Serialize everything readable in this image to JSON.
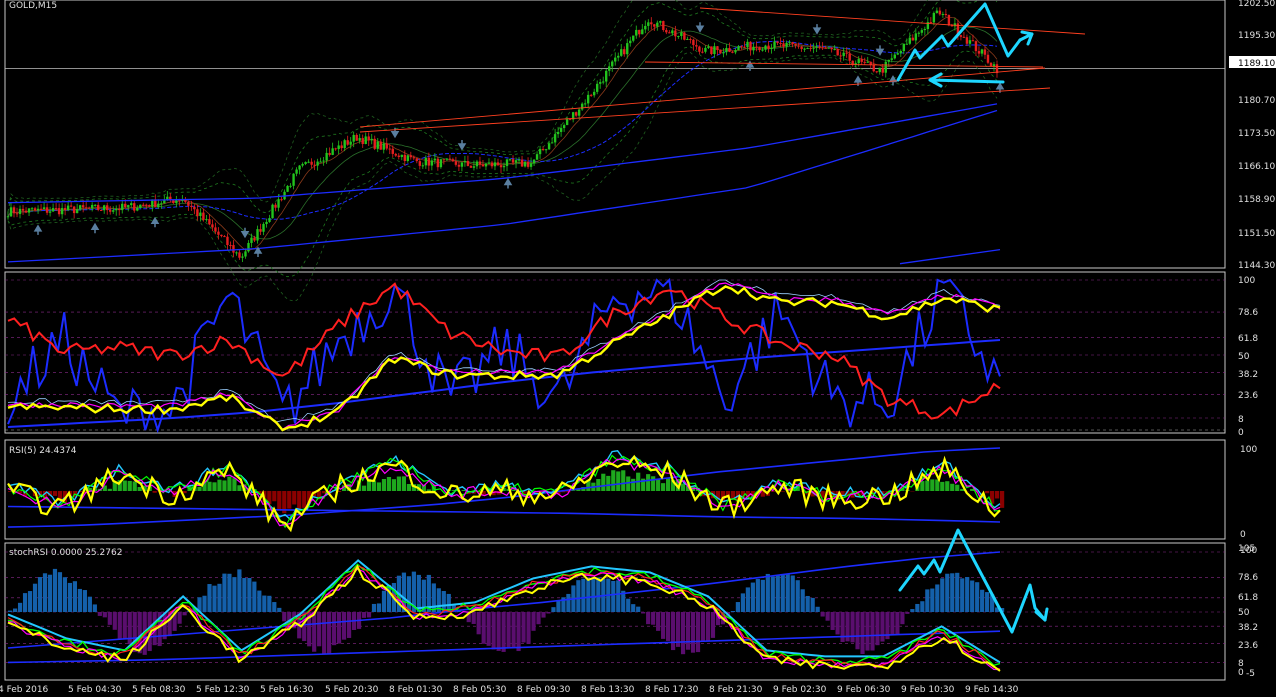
{
  "colors": {
    "background": "#000000",
    "frame": "#c8c8c8",
    "grid": "#3a3a3a",
    "bull_candle": "#22c41d",
    "bear_candle": "#e51f1f",
    "fractal_arrow": "#5a7fa0",
    "trendline": "#ff4020",
    "channel": "#1c2cff",
    "annotation": "#1ed6ff",
    "band_dashed": "#1f7a1f",
    "price_line": "#c0c0c0",
    "yellow": "#ffff00",
    "red": "#ff2020",
    "blue": "#1c2cff",
    "cyan": "#23c7ff",
    "magenta": "#ff00ff",
    "green": "#00ff00",
    "hist_green": "#1ea81e",
    "hist_red": "#8b0000",
    "hist_blue": "#1460aa",
    "hist_purple": "#5a0e6e",
    "level_dash": "#8a2a8a"
  },
  "chart_data": [
    {
      "panel": "main",
      "type": "candlestick",
      "title": "GOLD,M15",
      "current_price_label": "1189.10",
      "y_tick_labels": [
        "1202.50",
        "1195.30",
        "1189.10",
        "1180.70",
        "1173.50",
        "1166.10",
        "1158.90",
        "1151.50",
        "1144.30"
      ],
      "ylim": [
        1144.3,
        1204.0
      ],
      "approx_close_path": [
        [
          "5 Feb 2016",
          1156.5
        ],
        [
          "5 Feb 04:30",
          1156.9
        ],
        [
          "5 Feb 08:30",
          1157.3
        ],
        [
          "5 Feb 12:30",
          1159.5
        ],
        [
          "5 Feb 16:30",
          1146.0
        ],
        [
          "5 Feb 20:30",
          1166.0
        ],
        [
          "5 Feb 22:30",
          1173.5
        ],
        [
          "8 Feb 01:30",
          1168.0
        ],
        [
          "8 Feb 05:30",
          1167.0
        ],
        [
          "8 Feb 09:30",
          1167.5
        ],
        [
          "8 Feb 13:30",
          1183.0
        ],
        [
          "8 Feb 17:30",
          1200.5
        ],
        [
          "8 Feb 21:30",
          1193.0
        ],
        [
          "9 Feb 02:30",
          1194.5
        ],
        [
          "9 Feb 06:30",
          1193.5
        ],
        [
          "9 Feb 10:30",
          1188.5
        ],
        [
          "9 Feb 14:30",
          1202.0
        ],
        [
          "9 Feb 15:30",
          1189.1
        ]
      ]
    },
    {
      "panel": "indicator-1",
      "type": "line",
      "y_tick_labels": [
        "100",
        "78.6",
        "61.8",
        "50",
        "38.2",
        "23.6",
        "8",
        "0"
      ],
      "ylim": [
        0,
        100
      ],
      "series": [
        {
          "color": "yellow",
          "values": [
            15,
            15,
            14,
            14,
            22,
            0,
            12,
            48,
            37,
            36,
            37,
            58,
            77,
            97,
            85,
            85,
            75,
            88,
            80
          ]
        },
        {
          "color": "red",
          "values": [
            74,
            52,
            55,
            50,
            60,
            35,
            70,
            96,
            65,
            52,
            48,
            78,
            95,
            75,
            58,
            50,
            20,
            10,
            30
          ]
        },
        {
          "color": "blue",
          "values": [
            20,
            60,
            10,
            15,
            90,
            10,
            60,
            95,
            20,
            55,
            20,
            90,
            95,
            20,
            80,
            20,
            20,
            95,
            30
          ]
        }
      ]
    },
    {
      "panel": "indicator-2",
      "type": "line",
      "label": "RSI(5) 24.4374",
      "y_tick_labels": [
        "100",
        "0"
      ],
      "ylim": [
        0,
        100
      ],
      "series": [
        {
          "name": "RSI(5)",
          "color": "yellow",
          "values": [
            50,
            30,
            70,
            45,
            75,
            10,
            55,
            80,
            45,
            50,
            45,
            85,
            70,
            30,
            55,
            40,
            45,
            75,
            24
          ]
        }
      ]
    },
    {
      "panel": "indicator-3",
      "type": "line",
      "label": "stochRSI 0.0000 25.2762",
      "y_tick_labels": [
        "105",
        "100",
        "78.6",
        "61.8",
        "50",
        "38.2",
        "23.6",
        "8",
        "0",
        "-5"
      ],
      "ylim": [
        -5,
        105
      ],
      "series": [
        {
          "name": "stochRSI",
          "color": "yellow",
          "values": [
            40,
            20,
            10,
            55,
            10,
            40,
            85,
            45,
            50,
            70,
            80,
            75,
            55,
            10,
            5,
            5,
            30,
            0
          ]
        }
      ]
    }
  ],
  "x_axis_labels": [
    "4 Feb 2016",
    "5 Feb 04:30",
    "5 Feb 08:30",
    "5 Feb 12:30",
    "5 Feb 16:30",
    "5 Feb 20:30",
    "8 Feb 01:30",
    "8 Feb 05:30",
    "8 Feb 09:30",
    "8 Feb 13:30",
    "8 Feb 17:30",
    "8 Feb 21:30",
    "9 Feb 02:30",
    "9 Feb 06:30",
    "9 Feb 10:30",
    "9 Feb 14:30"
  ]
}
